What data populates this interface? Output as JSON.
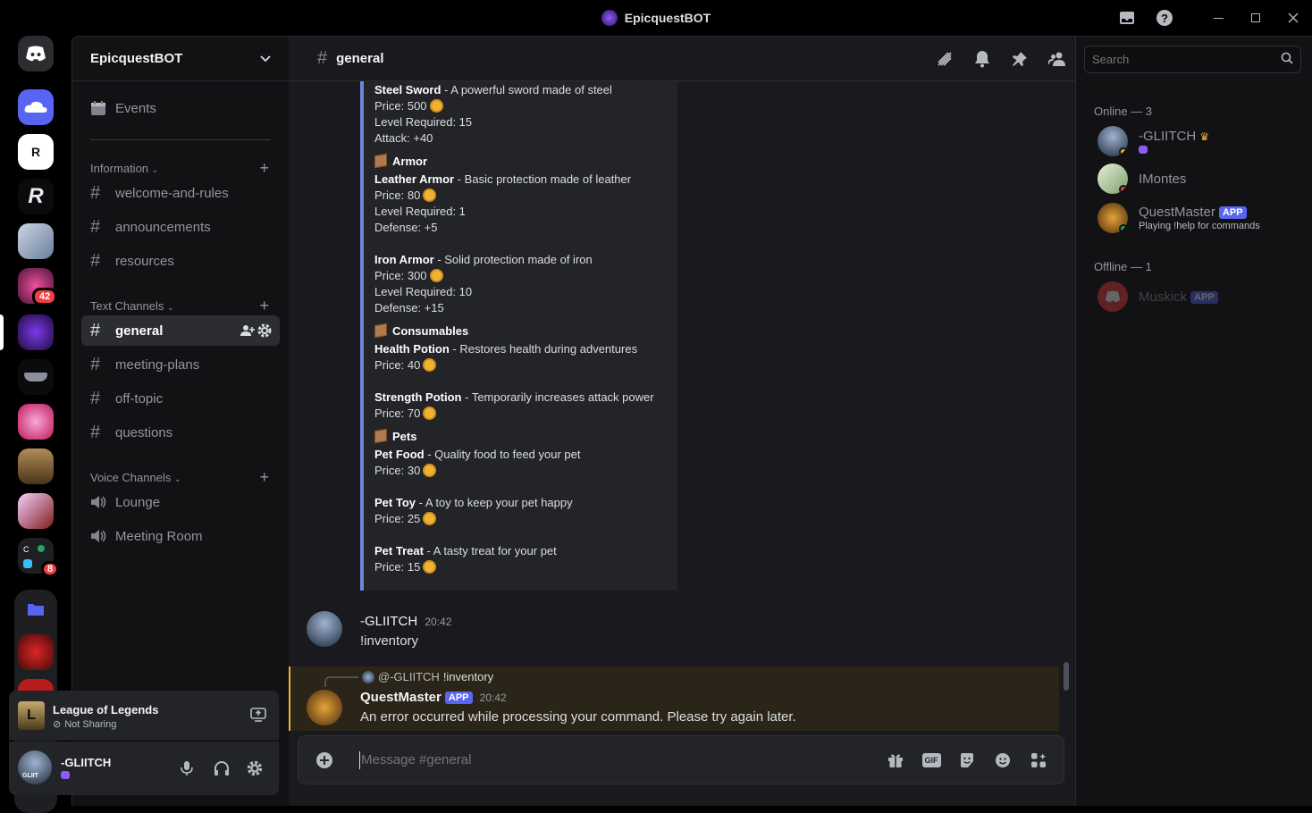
{
  "window": {
    "title": "EpicquestBOT"
  },
  "guilds": {
    "badges": [
      "42",
      "8"
    ]
  },
  "sidebar": {
    "server_name": "EpicquestBOT",
    "events_label": "Events",
    "categories": {
      "information": "Information",
      "text": "Text Channels",
      "voice": "Voice Channels"
    },
    "info_channels": [
      "welcome-and-rules",
      "announcements",
      "resources"
    ],
    "text_channels": [
      "general",
      "meeting-plans",
      "off-topic",
      "questions"
    ],
    "voice_channels": [
      "Lounge",
      "Meeting Room"
    ]
  },
  "activity": {
    "game": "League of Legends",
    "status": "Not Sharing"
  },
  "user": {
    "name": "-GLIITCH",
    "avatar_text": "GLIIT"
  },
  "channel": {
    "name": "general"
  },
  "search": {
    "placeholder": "Search"
  },
  "embed": {
    "steel_sword": {
      "name": "Steel Sword",
      "desc": " - A powerful sword made of steel",
      "price": "Price: 500",
      "level": "Level Required: 15",
      "stat": "Attack: +40"
    },
    "armor_heading": "Armor",
    "leather_armor": {
      "name": "Leather Armor",
      "desc": " - Basic protection made of leather",
      "price": "Price: 80",
      "level": "Level Required: 1",
      "stat": "Defense: +5"
    },
    "iron_armor": {
      "name": "Iron Armor",
      "desc": " - Solid protection made of iron",
      "price": "Price: 300",
      "level": "Level Required: 10",
      "stat": "Defense: +15"
    },
    "consumables_heading": "Consumables",
    "health_potion": {
      "name": "Health Potion",
      "desc": " - Restores health during adventures",
      "price": "Price: 40"
    },
    "strength_potion": {
      "name": "Strength Potion",
      "desc": " - Temporarily increases attack power",
      "price": "Price: 70"
    },
    "pets_heading": "Pets",
    "pet_food": {
      "name": "Pet Food",
      "desc": " - Quality food to feed your pet",
      "price": "Price: 30"
    },
    "pet_toy": {
      "name": "Pet Toy",
      "desc": " - A toy to keep your pet happy",
      "price": "Price: 25"
    },
    "pet_treat": {
      "name": "Pet Treat",
      "desc": " - A tasty treat for your pet",
      "price": "Price: 15"
    }
  },
  "messages": [
    {
      "author": "-GLIITCH",
      "time": "20:42",
      "text": "!inventory"
    },
    {
      "reply_author": "@-GLIITCH",
      "reply_text": "!inventory",
      "author": "QuestMaster",
      "tag": "APP",
      "time": "20:42",
      "text": "An error occurred while processing your command. Please try again later."
    }
  ],
  "composer": {
    "placeholder": "Message #general",
    "gif_label": "GIF"
  },
  "members": {
    "online_heading": "Online — 3",
    "offline_heading": "Offline — 1",
    "online": [
      {
        "name": "-GLIITCH"
      },
      {
        "name": "IMontes"
      },
      {
        "name": "QuestMaster",
        "tag": "APP",
        "activity": "Playing !help for commands"
      }
    ],
    "offline": [
      {
        "name": "Muskick",
        "tag": "APP"
      }
    ]
  },
  "colors": {
    "accent": "#5865f2",
    "embed_border": "#6f86d6",
    "coin": "#f0b232",
    "online": "#23a55a",
    "dnd": "#f23f43"
  }
}
